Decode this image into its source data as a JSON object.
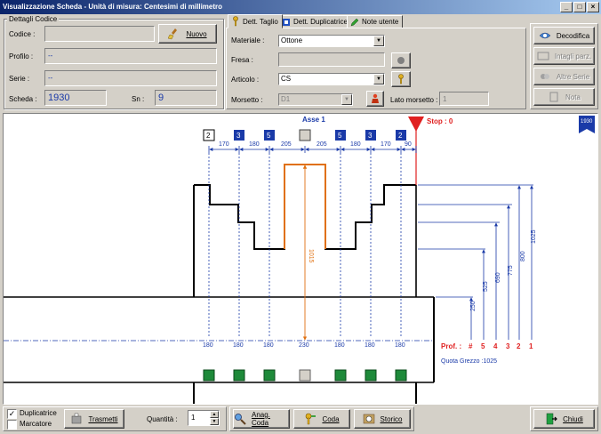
{
  "window": {
    "title": "Visualizzazione Scheda - Unità di misura: Centesimi di millimetro"
  },
  "details": {
    "legend": "Dettagli Codice",
    "codice_label": "Codice :",
    "codice_value": "",
    "nuovo_label": "Nuovo",
    "profilo_label": "Profilo :",
    "profilo_value": "--",
    "serie_label": "Serie :",
    "serie_value": "--",
    "scheda_label": "Scheda :",
    "scheda_value": "1930",
    "sn_label": "Sn :",
    "sn_value": "9"
  },
  "tabs": [
    {
      "label": "Dett. Taglio",
      "icon": "key-icon"
    },
    {
      "label": "Dett. Duplicatrice",
      "icon": "machine-icon"
    },
    {
      "label": "Note utente",
      "icon": "pencil-icon"
    }
  ],
  "taglio": {
    "materiale_label": "Materiale :",
    "materiale_value": "Ottone",
    "fresa_label": "Fresa :",
    "fresa_value": "",
    "articolo_label": "Articolo :",
    "articolo_value": "CS",
    "morsetto_label": "Morsetto :",
    "morsetto_value": "D1",
    "lato_label": "Lato morsetto :",
    "lato_value": "1"
  },
  "right_buttons": [
    {
      "label": "Decodifica",
      "enabled": true
    },
    {
      "label": "Intagli parz.",
      "enabled": false
    },
    {
      "label": "Altre Serie",
      "enabled": false
    },
    {
      "label": "Nota",
      "enabled": false
    }
  ],
  "drawing": {
    "axis_label": "Asse 1",
    "stop_label": "Stop : 0",
    "scheda_flag": "1930",
    "cut_codes": [
      "2",
      "3",
      "5",
      "",
      "5",
      "3",
      "2"
    ],
    "top_spacings": [
      "170",
      "180",
      "205",
      "205",
      "180",
      "170",
      "90"
    ],
    "bottom_values": [
      "180",
      "180",
      "180",
      "230",
      "180",
      "180",
      "180"
    ],
    "center_depth": "1015",
    "prof_label": "Prof. :",
    "prof_values": [
      "#",
      "5",
      "4",
      "3",
      "2",
      "1"
    ],
    "right_dims": [
      "250",
      "525",
      "690",
      "775",
      "800",
      "1025"
    ],
    "quota_label": "Quota Grezzo :1025"
  },
  "bottom": {
    "duplicatrice_label": "Duplicatrice",
    "marcatore_label": "Marcatore",
    "trasmetti_label": "Trasmetti",
    "quantita_label": "Quantità :",
    "quantita_value": "1",
    "anag_label": "Anag. Coda",
    "coda_label": "Coda",
    "storico_label": "Storico",
    "chiudi_label": "Chiudi"
  },
  "colors": {
    "titlebar": "#0a246a",
    "blue_dim": "#1a3aa8",
    "orange": "#e07010",
    "red": "#e02020",
    "green": "#1e8a3a"
  }
}
